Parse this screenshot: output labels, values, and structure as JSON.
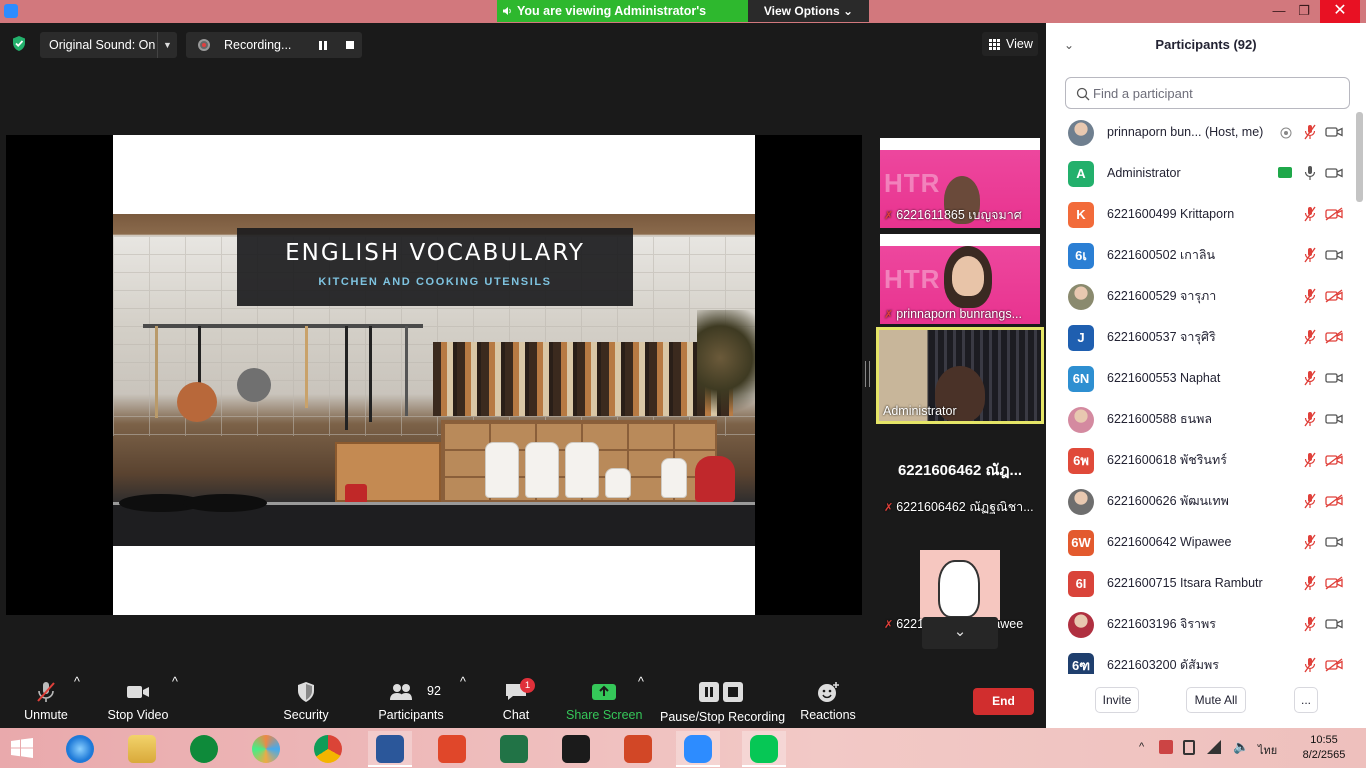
{
  "titlebar": {
    "share_banner": "You are viewing Administrator's screen",
    "view_options": "View Options",
    "minimize": "—",
    "restore": "❐",
    "close": "✕"
  },
  "topbar": {
    "original_sound": "Original Sound: On",
    "recording": "Recording...",
    "view": "View"
  },
  "slide": {
    "title": "ENGLISH  VOCABULARY",
    "subtitle": "KITCHEN  AND COOKING UTENSILS"
  },
  "thumbnails": [
    {
      "name": "6221611865 เบญจมาศ",
      "muted": true
    },
    {
      "name": "prinnaporn bunrangs...",
      "muted": true
    },
    {
      "name": "Administrator",
      "muted": false,
      "active": true
    },
    {
      "big_name": "6221606462 ณัฎ...",
      "name": "6221606462 ณัฏฐณิชา...",
      "muted": true
    },
    {
      "name": "6221611873 panrawee",
      "muted": true
    }
  ],
  "toolbar": {
    "unmute": "Unmute",
    "stop_video": "Stop Video",
    "security": "Security",
    "participants": "Participants",
    "participants_count": "92",
    "chat": "Chat",
    "chat_badge": "1",
    "share_screen": "Share Screen",
    "pause_stop_recording": "Pause/Stop Recording",
    "reactions": "Reactions",
    "end": "End"
  },
  "panel": {
    "title": "Participants (92)",
    "search_placeholder": "Find a participant",
    "participants": [
      {
        "name": "prinnaporn bun...  (Host, me)",
        "avatar": "",
        "avatar_color": "#6f7f8f",
        "photo": true,
        "mic": "off",
        "cam": "on",
        "record": true
      },
      {
        "name": "Administrator",
        "avatar": "A",
        "avatar_color": "#23b06c",
        "mic": "on",
        "cam": "on",
        "sharing": true
      },
      {
        "name": "6221600499 Krittaporn",
        "avatar": "K",
        "avatar_color": "#f26b3a",
        "mic": "off",
        "cam": "off"
      },
      {
        "name": "6221600502 เกาลิน",
        "avatar": "6เ",
        "avatar_color": "#2b7fd4",
        "mic": "off",
        "cam": "on"
      },
      {
        "name": "6221600529 จารุภา",
        "avatar": "",
        "avatar_color": "#8a8a6e",
        "photo": true,
        "mic": "off",
        "cam": "off"
      },
      {
        "name": "6221600537 จารุศิริ",
        "avatar": "J",
        "avatar_color": "#1f5fb0",
        "mic": "off",
        "cam": "off"
      },
      {
        "name": "6221600553 Naphat",
        "avatar": "6N",
        "avatar_color": "#2e8fd1",
        "mic": "off",
        "cam": "on"
      },
      {
        "name": "6221600588 ธนพล",
        "avatar": "",
        "avatar_color": "#d48aa0",
        "photo": true,
        "mic": "off",
        "cam": "on"
      },
      {
        "name": "6221600618 พัชรินทร์",
        "avatar": "6พ",
        "avatar_color": "#e04a3a",
        "mic": "off",
        "cam": "off"
      },
      {
        "name": "6221600626 พัฒนเทพ",
        "avatar": "",
        "avatar_color": "#6e6e6e",
        "photo": true,
        "mic": "off",
        "cam": "off"
      },
      {
        "name": "6221600642 Wipawee",
        "avatar": "6W",
        "avatar_color": "#e35a2e",
        "mic": "off",
        "cam": "on"
      },
      {
        "name": "6221600715 Itsara Rambutr",
        "avatar": "6I",
        "avatar_color": "#d9443a",
        "mic": "off",
        "cam": "off"
      },
      {
        "name": "6221603196 จิราพร",
        "avatar": "",
        "avatar_color": "#b03040",
        "photo": true,
        "mic": "off",
        "cam": "on"
      },
      {
        "name": "6221603200 ดัสัมพร",
        "avatar": "6ฑ",
        "avatar_color": "#1f3f6e",
        "mic": "off",
        "cam": "off"
      }
    ],
    "invite": "Invite",
    "mute_all": "Mute All",
    "more": "..."
  },
  "taskbar": {
    "lang": "ไทย",
    "time": "10:55",
    "date": "8/2/2565"
  },
  "colors": {
    "zoom_blue": "#2d8cff",
    "end_red": "#d12e2e",
    "share_green": "#2eb82e",
    "muted_red": "#e0403a"
  }
}
